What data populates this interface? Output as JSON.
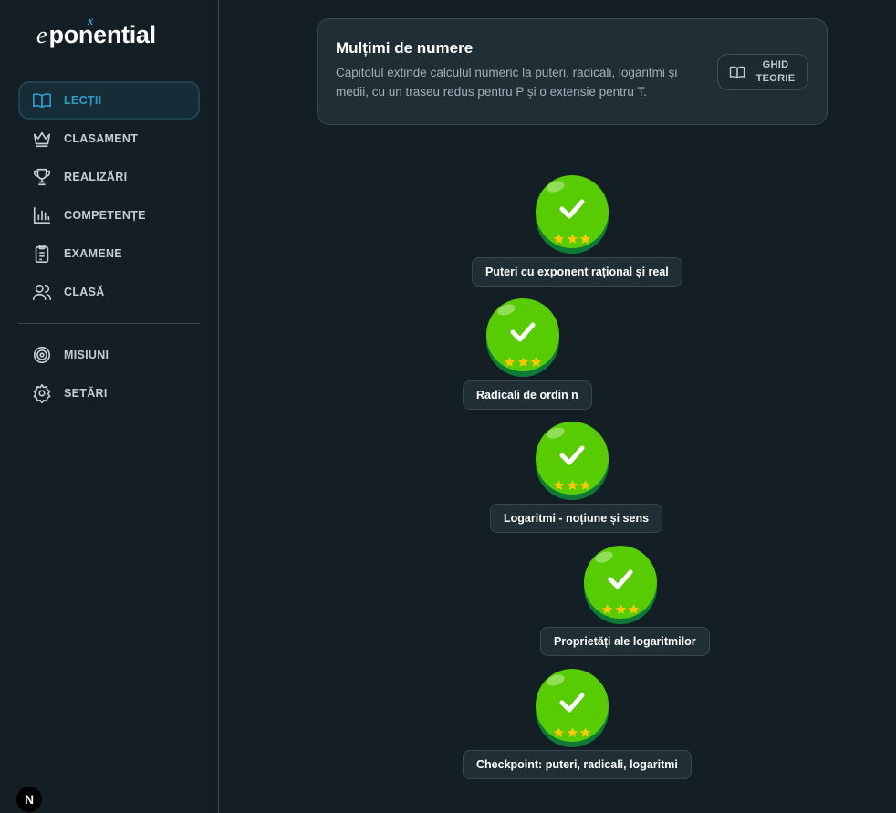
{
  "brand": {
    "logo_e": "e",
    "logo_x": "x",
    "logo_rest": "ponential"
  },
  "sidebar": {
    "items": [
      {
        "label": "LECȚII",
        "icon": "book-icon",
        "active": true
      },
      {
        "label": "CLASAMENT",
        "icon": "crown-icon",
        "active": false
      },
      {
        "label": "REALIZĂRI",
        "icon": "trophy-icon",
        "active": false
      },
      {
        "label": "COMPETENȚE",
        "icon": "bar-chart-icon",
        "active": false
      },
      {
        "label": "EXAMENE",
        "icon": "clipboard-icon",
        "active": false
      },
      {
        "label": "CLASĂ",
        "icon": "users-icon",
        "active": false
      }
    ],
    "secondary": [
      {
        "label": "MISIUNI",
        "icon": "target-icon"
      },
      {
        "label": "SETĂRI",
        "icon": "gear-icon"
      }
    ]
  },
  "header": {
    "title": "Mulțimi de numere",
    "description": "Capitolul extinde calculul numeric la puteri, radicali, logaritmi și medii, cu un traseu redus pentru P și o extensie pentru T.",
    "guide_label": "GHID TEORIE"
  },
  "lessons": [
    {
      "label": "Puteri cu exponent rațional și real",
      "status": "completed",
      "stars": 3
    },
    {
      "label": "Radicali de ordin n",
      "status": "completed",
      "stars": 3
    },
    {
      "label": "Logaritmi - noțiune și sens",
      "status": "completed",
      "stars": 3
    },
    {
      "label": "Proprietăți ale logaritmilor",
      "status": "completed",
      "stars": 3
    },
    {
      "label": "Checkpoint: puteri, radicali, logaritmi",
      "status": "completed",
      "stars": 3
    }
  ],
  "colors": {
    "background": "#131f24",
    "accent": "#2d9cc9",
    "node_green": "#58cc02",
    "node_shadow": "#0f7a37",
    "star": "#ffc800"
  },
  "dev_badge": "N"
}
